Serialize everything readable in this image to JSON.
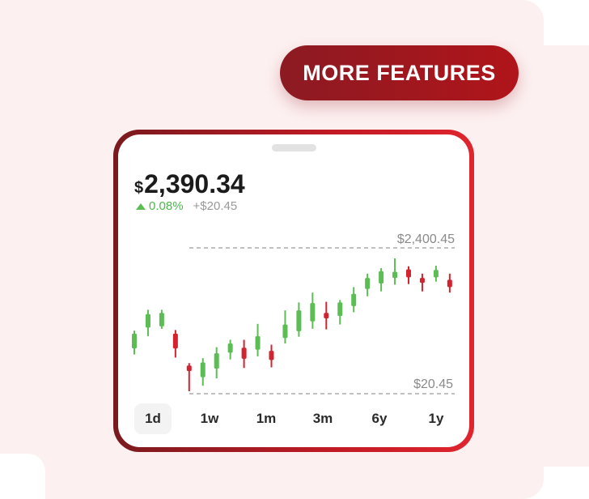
{
  "header": {
    "more_features_label": "MORE FEATURES"
  },
  "quote": {
    "currency_symbol": "$",
    "price": "2,390.34",
    "change_percent": "0.08%",
    "change_amount": "+$20.45"
  },
  "colors": {
    "up": "#5cbd55",
    "down": "#d2232f",
    "accent": "#b0151a"
  },
  "icons": {
    "change_direction": "triangle-up-icon"
  },
  "chart_data": {
    "type": "candlestick",
    "ylim": [
      20.45,
      2400.45
    ],
    "reference_lines": [
      {
        "label": "$2,400.45",
        "value": 2400.45
      },
      {
        "label": "$20.45",
        "value": 20.45
      }
    ],
    "candles": [
      {
        "dir": "up",
        "high": 1050,
        "open": 760,
        "close": 1000,
        "low": 660
      },
      {
        "dir": "up",
        "high": 1390,
        "open": 1100,
        "close": 1320,
        "low": 960
      },
      {
        "dir": "up",
        "high": 1390,
        "open": 1120,
        "close": 1340,
        "low": 1080
      },
      {
        "dir": "down",
        "high": 1060,
        "open": 1000,
        "close": 760,
        "low": 610
      },
      {
        "dir": "down",
        "high": 520,
        "open": 480,
        "close": 390,
        "low": 60
      },
      {
        "dir": "up",
        "high": 600,
        "open": 290,
        "close": 530,
        "low": 150
      },
      {
        "dir": "up",
        "high": 780,
        "open": 430,
        "close": 680,
        "low": 270
      },
      {
        "dir": "up",
        "high": 900,
        "open": 690,
        "close": 840,
        "low": 580
      },
      {
        "dir": "down",
        "high": 900,
        "open": 770,
        "close": 590,
        "low": 440
      },
      {
        "dir": "up",
        "high": 1160,
        "open": 740,
        "close": 960,
        "low": 630
      },
      {
        "dir": "down",
        "high": 820,
        "open": 720,
        "close": 570,
        "low": 450
      },
      {
        "dir": "up",
        "high": 1380,
        "open": 930,
        "close": 1150,
        "low": 840
      },
      {
        "dir": "up",
        "high": 1510,
        "open": 1040,
        "close": 1380,
        "low": 950
      },
      {
        "dir": "up",
        "high": 1670,
        "open": 1200,
        "close": 1500,
        "low": 1080
      },
      {
        "dir": "down",
        "high": 1520,
        "open": 1340,
        "close": 1250,
        "low": 1070
      },
      {
        "dir": "up",
        "high": 1550,
        "open": 1290,
        "close": 1510,
        "low": 1150
      },
      {
        "dir": "up",
        "high": 1760,
        "open": 1450,
        "close": 1650,
        "low": 1350
      },
      {
        "dir": "up",
        "high": 1980,
        "open": 1730,
        "close": 1910,
        "low": 1610
      },
      {
        "dir": "up",
        "high": 2070,
        "open": 1820,
        "close": 2020,
        "low": 1690
      },
      {
        "dir": "up",
        "high": 2230,
        "open": 1910,
        "close": 2010,
        "low": 1800
      },
      {
        "dir": "down",
        "high": 2100,
        "open": 2050,
        "close": 1920,
        "low": 1810
      },
      {
        "dir": "down",
        "high": 1980,
        "open": 1910,
        "close": 1830,
        "low": 1690
      },
      {
        "dir": "up",
        "high": 2110,
        "open": 1920,
        "close": 2040,
        "low": 1850
      },
      {
        "dir": "down",
        "high": 1980,
        "open": 1880,
        "close": 1760,
        "low": 1670
      }
    ]
  },
  "ranges": {
    "items": [
      {
        "label": "1d",
        "active": true
      },
      {
        "label": "1w",
        "active": false
      },
      {
        "label": "1m",
        "active": false
      },
      {
        "label": "3m",
        "active": false
      },
      {
        "label": "6y",
        "active": false
      },
      {
        "label": "1y",
        "active": false
      }
    ]
  }
}
